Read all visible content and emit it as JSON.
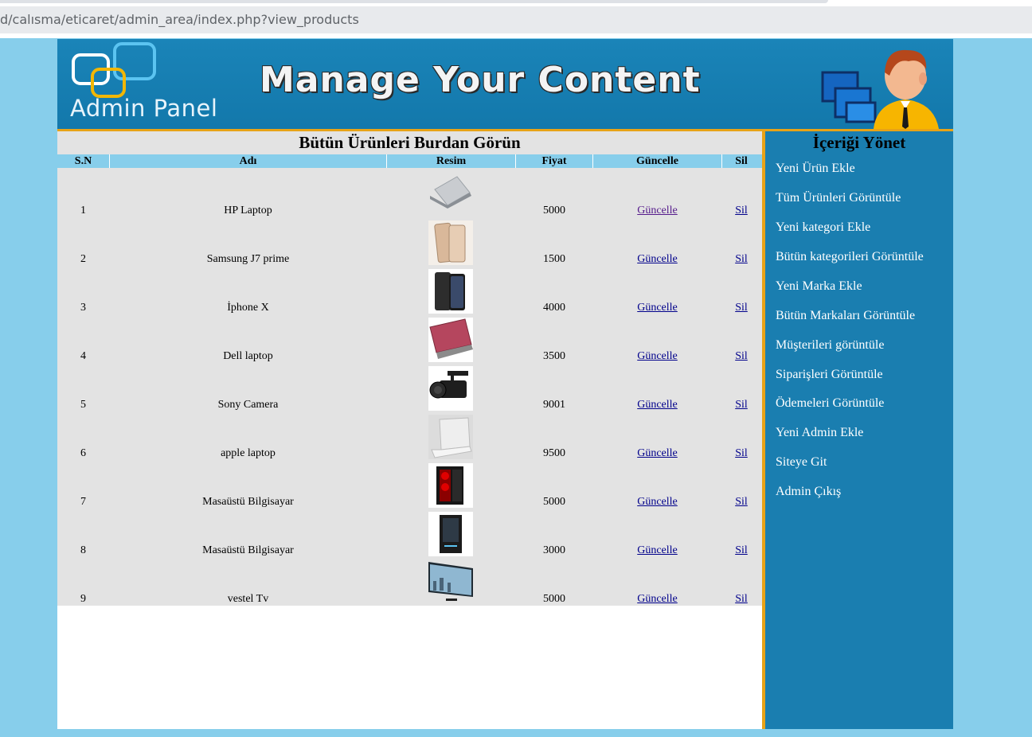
{
  "browser": {
    "url": "d/calısma/eticaret/admin_area/index.php?view_products"
  },
  "header": {
    "logo_text": "Admin Panel",
    "banner_title": "Manage Your Content"
  },
  "main": {
    "title": "Bütün Ürünleri Burdan Görün",
    "columns": [
      "S.N",
      "Adı",
      "Resim",
      "Fiyat",
      "Güncelle",
      "Sil"
    ],
    "rows": [
      {
        "sn": "1",
        "name": "HP Laptop",
        "price": "5000",
        "edit": "Güncelle",
        "delete": "Sil",
        "image": "laptop-silver"
      },
      {
        "sn": "2",
        "name": "Samsung J7 prime",
        "price": "1500",
        "edit": "Güncelle",
        "delete": "Sil",
        "image": "phone-gold"
      },
      {
        "sn": "3",
        "name": "İphone X",
        "price": "4000",
        "edit": "Güncelle",
        "delete": "Sil",
        "image": "phone-black"
      },
      {
        "sn": "4",
        "name": "Dell laptop",
        "price": "3500",
        "edit": "Güncelle",
        "delete": "Sil",
        "image": "laptop-red"
      },
      {
        "sn": "5",
        "name": "Sony Camera",
        "price": "9001",
        "edit": "Güncelle",
        "delete": "Sil",
        "image": "camcorder"
      },
      {
        "sn": "6",
        "name": "apple laptop",
        "price": "9500",
        "edit": "Güncelle",
        "delete": "Sil",
        "image": "laptop-white"
      },
      {
        "sn": "7",
        "name": "Masaüstü Bilgisayar",
        "price": "5000",
        "edit": "Güncelle",
        "delete": "Sil",
        "image": "pc-case-red"
      },
      {
        "sn": "8",
        "name": "Masaüstü Bilgisayar",
        "price": "3000",
        "edit": "Güncelle",
        "delete": "Sil",
        "image": "pc-case-black"
      },
      {
        "sn": "9",
        "name": "vestel Tv",
        "price": "5000",
        "edit": "Güncelle",
        "delete": "Sil",
        "image": "tv"
      }
    ]
  },
  "sidebar": {
    "title": "İçeriği Yönet",
    "links": [
      "Yeni Ürün Ekle",
      "Tüm Ürünleri Görüntüle",
      "Yeni kategori Ekle",
      "Bütün kategorileri Görüntüle",
      "Yeni Marka Ekle",
      "Bütün Markaları Görüntüle",
      "Müşterileri görüntüle",
      "Siparişleri Görüntüle",
      "Ödemeleri Görüntüle",
      "Yeni Admin Ekle",
      "Siteye Git",
      "Admin Çıkış"
    ]
  },
  "colors": {
    "page_bg": "#87ceeb",
    "header_bg": "#1a84b8",
    "accent": "#e8a317",
    "sidebar_bg": "#1a7eb0",
    "table_bg": "#e3e3e3"
  }
}
